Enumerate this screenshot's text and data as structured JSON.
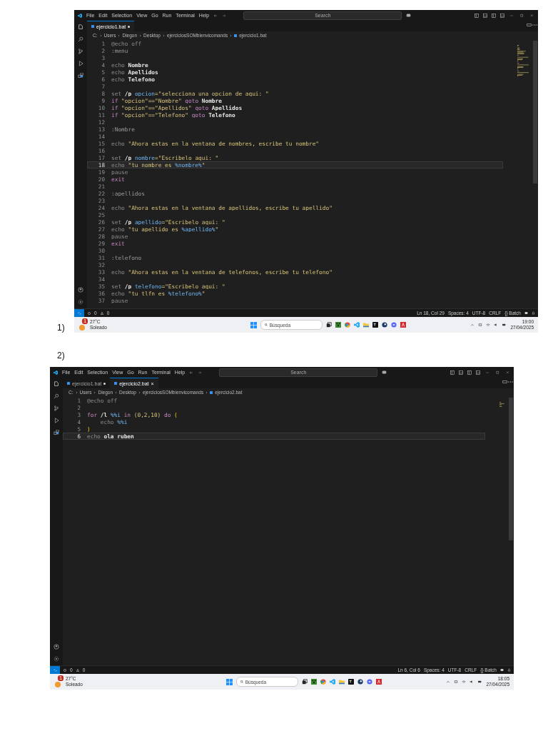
{
  "screenshots": [
    {
      "caption": "1)",
      "menu": [
        "File",
        "Edit",
        "Selection",
        "View",
        "Go",
        "Run",
        "Terminal",
        "Help"
      ],
      "search": {
        "placeholder": "Search"
      },
      "tabs": [
        {
          "label": "ejercicio1.bat",
          "selected": true,
          "modified": true
        }
      ],
      "breadcrumb": [
        "C:",
        "Users",
        "Diegon",
        "Desktop",
        "ejerciciosSOMbienvicomands",
        "ejercicio1.bat"
      ],
      "lines": [
        {
          "number": "1",
          "current": false,
          "tokens": [
            {
              "text": "@echo off",
              "kind": "command"
            }
          ]
        },
        {
          "number": "2",
          "current": false,
          "tokens": [
            {
              "text": ":menu",
              "kind": "label"
            }
          ]
        },
        {
          "number": "3",
          "current": false
        },
        {
          "number": "4",
          "current": false,
          "tokens": [
            {
              "text": "echo ",
              "kind": "command"
            },
            {
              "text": "Nombre",
              "kind": "text"
            }
          ]
        },
        {
          "number": "5",
          "current": false,
          "tokens": [
            {
              "text": "echo ",
              "kind": "command"
            },
            {
              "text": "Apellidos",
              "kind": "text"
            }
          ]
        },
        {
          "number": "6",
          "current": false,
          "tokens": [
            {
              "text": "echo ",
              "kind": "command"
            },
            {
              "text": "Telefono",
              "kind": "text"
            }
          ]
        },
        {
          "number": "7",
          "current": false
        },
        {
          "number": "8",
          "current": false,
          "tokens": [
            {
              "text": "set ",
              "kind": "command"
            },
            {
              "text": "/p ",
              "kind": "text"
            },
            {
              "text": "opcion",
              "kind": "variable"
            },
            {
              "text": "=\"selecciona una opcion de aqui: \"",
              "kind": "string"
            }
          ]
        },
        {
          "number": "9",
          "current": false,
          "tokens": [
            {
              "text": "if ",
              "kind": "keyword"
            },
            {
              "text": "\"opcion\"==\"Nombre\" ",
              "kind": "string"
            },
            {
              "text": "goto ",
              "kind": "keyword"
            },
            {
              "text": "Nombre",
              "kind": "text"
            }
          ]
        },
        {
          "number": "10",
          "current": false,
          "tokens": [
            {
              "text": "if ",
              "kind": "keyword"
            },
            {
              "text": "\"opcion\"==\"Apellidos\" ",
              "kind": "string"
            },
            {
              "text": "goto ",
              "kind": "keyword"
            },
            {
              "text": "Apellidos",
              "kind": "text"
            }
          ]
        },
        {
          "number": "11",
          "current": false,
          "tokens": [
            {
              "text": "if ",
              "kind": "keyword"
            },
            {
              "text": "\"opcion\"==\"Telefono\" ",
              "kind": "string"
            },
            {
              "text": "goto ",
              "kind": "keyword"
            },
            {
              "text": "Telefono",
              "kind": "text"
            }
          ]
        },
        {
          "number": "12",
          "current": false
        },
        {
          "number": "13",
          "current": false,
          "tokens": [
            {
              "text": ":Nombre",
              "kind": "label"
            }
          ]
        },
        {
          "number": "14",
          "current": false
        },
        {
          "number": "15",
          "current": false,
          "tokens": [
            {
              "text": "echo ",
              "kind": "command"
            },
            {
              "text": "\"Ahora estas en la ventana de nombres, escribe tu nombre\"",
              "kind": "string"
            }
          ]
        },
        {
          "number": "16",
          "current": false
        },
        {
          "number": "17",
          "current": false,
          "tokens": [
            {
              "text": "set ",
              "kind": "command"
            },
            {
              "text": "/p ",
              "kind": "text"
            },
            {
              "text": "nombre",
              "kind": "variable"
            },
            {
              "text": "=\"Escribelo aqui: \"",
              "kind": "string"
            }
          ]
        },
        {
          "number": "18",
          "current": true,
          "tokens": [
            {
              "text": "echo ",
              "kind": "command"
            },
            {
              "text": "\"tu nombre es ",
              "kind": "string"
            },
            {
              "text": "%nombre%",
              "kind": "variable"
            },
            {
              "text": "\"",
              "kind": "string"
            }
          ]
        },
        {
          "number": "19",
          "current": false,
          "tokens": [
            {
              "text": "pause",
              "kind": "command"
            }
          ]
        },
        {
          "number": "20",
          "current": false,
          "tokens": [
            {
              "text": "exit",
              "kind": "keyword"
            }
          ]
        },
        {
          "number": "21",
          "current": false
        },
        {
          "number": "22",
          "current": false,
          "tokens": [
            {
              "text": ":apellidos",
              "kind": "label"
            }
          ]
        },
        {
          "number": "23",
          "current": false
        },
        {
          "number": "24",
          "current": false,
          "tokens": [
            {
              "text": "echo ",
              "kind": "command"
            },
            {
              "text": "\"Ahora estas en la ventana de apellidos, escribe tu apellido\"",
              "kind": "string"
            }
          ]
        },
        {
          "number": "25",
          "current": false
        },
        {
          "number": "26",
          "current": false,
          "tokens": [
            {
              "text": "set ",
              "kind": "command"
            },
            {
              "text": "/p ",
              "kind": "text"
            },
            {
              "text": "apellido",
              "kind": "variable"
            },
            {
              "text": "=\"Escribelo aqui: \"",
              "kind": "string"
            }
          ]
        },
        {
          "number": "27",
          "current": false,
          "tokens": [
            {
              "text": "echo ",
              "kind": "command"
            },
            {
              "text": "\"tu apellido es ",
              "kind": "string"
            },
            {
              "text": "%apellido%",
              "kind": "variable"
            },
            {
              "text": "\"",
              "kind": "string"
            }
          ]
        },
        {
          "number": "28",
          "current": false,
          "tokens": [
            {
              "text": "pause",
              "kind": "command"
            }
          ]
        },
        {
          "number": "29",
          "current": false,
          "tokens": [
            {
              "text": "exit",
              "kind": "keyword"
            }
          ]
        },
        {
          "number": "30",
          "current": false
        },
        {
          "number": "31",
          "current": false,
          "tokens": [
            {
              "text": ":telefono",
              "kind": "label"
            }
          ]
        },
        {
          "number": "32",
          "current": false
        },
        {
          "number": "33",
          "current": false,
          "tokens": [
            {
              "text": "echo ",
              "kind": "command"
            },
            {
              "text": "\"Ahora estas en la ventana de telefonos, escribe tu telefono\"",
              "kind": "string"
            }
          ]
        },
        {
          "number": "34",
          "current": false
        },
        {
          "number": "35",
          "current": false,
          "tokens": [
            {
              "text": "set ",
              "kind": "command"
            },
            {
              "text": "/p ",
              "kind": "text"
            },
            {
              "text": "telefono",
              "kind": "variable"
            },
            {
              "text": "=\"Escribelo aqui: \"",
              "kind": "string"
            }
          ]
        },
        {
          "number": "36",
          "current": false,
          "tokens": [
            {
              "text": "echo ",
              "kind": "command"
            },
            {
              "text": "\"tu tlfn es ",
              "kind": "string"
            },
            {
              "text": "%telefono%",
              "kind": "variable"
            },
            {
              "text": "\"",
              "kind": "string"
            }
          ]
        },
        {
          "number": "37",
          "current": false,
          "tokens": [
            {
              "text": "pause",
              "kind": "command"
            }
          ]
        }
      ],
      "status": {
        "errors": "0",
        "warnings": "0",
        "items": [
          "Ln 18, Col 29",
          "Spaces: 4",
          "UTF-8",
          "CRLF",
          "{} Batch"
        ]
      },
      "taskbar": {
        "temperature": "27°C",
        "weather": "Soleado",
        "badge": "1",
        "search": {
          "placeholder": "Búsqueda"
        },
        "time": "19:00",
        "date": "27/04/2025"
      }
    },
    {
      "caption": "2)",
      "menu": [
        "File",
        "Edit",
        "Selection",
        "View",
        "Go",
        "Run",
        "Terminal",
        "Help"
      ],
      "search": {
        "placeholder": "Search"
      },
      "tabs": [
        {
          "label": "ejercicio1.bat",
          "selected": false,
          "modified": true
        },
        {
          "label": "ejercicio2.bat",
          "selected": true,
          "modified": false,
          "close": "×"
        }
      ],
      "breadcrumb": [
        "C:",
        "Users",
        "Diegon",
        "Desktop",
        "ejerciciosSOMbienvicomands",
        "ejercicio2.bat"
      ],
      "lines": [
        {
          "number": "1",
          "current": false,
          "tokens": [
            {
              "text": "@echo off",
              "kind": "command"
            }
          ]
        },
        {
          "number": "2",
          "current": false
        },
        {
          "number": "3",
          "current": false,
          "tokens": [
            {
              "text": "for ",
              "kind": "keyword"
            },
            {
              "text": "/l ",
              "kind": "text"
            },
            {
              "text": "%%i ",
              "kind": "variable"
            },
            {
              "text": "in ",
              "kind": "keyword"
            },
            {
              "text": "(0,2,10) ",
              "kind": "number"
            },
            {
              "text": "do ",
              "kind": "keyword"
            },
            {
              "text": "(",
              "kind": "bracket"
            }
          ]
        },
        {
          "number": "4",
          "current": false,
          "tokens": [
            {
              "text": "    echo ",
              "kind": "command"
            },
            {
              "text": "%%i",
              "kind": "variable"
            }
          ]
        },
        {
          "number": "5",
          "current": false,
          "tokens": [
            {
              "text": ")",
              "kind": "bracket"
            }
          ]
        },
        {
          "number": "6",
          "current": true,
          "tokens": [
            {
              "text": "echo ",
              "kind": "command"
            },
            {
              "text": "ola ruben",
              "kind": "text"
            }
          ]
        }
      ],
      "status": {
        "errors": "0",
        "warnings": "0",
        "items": [
          "Ln 6, Col 6",
          "Spaces: 4",
          "UTF-8",
          "CRLF",
          "{} Batch"
        ]
      },
      "taskbar": {
        "temperature": "27°C",
        "weather": "Soleado",
        "badge": "1",
        "search": {
          "placeholder": "Búsqueda"
        },
        "time": "18:05",
        "date": "27/04/2025"
      }
    }
  ]
}
